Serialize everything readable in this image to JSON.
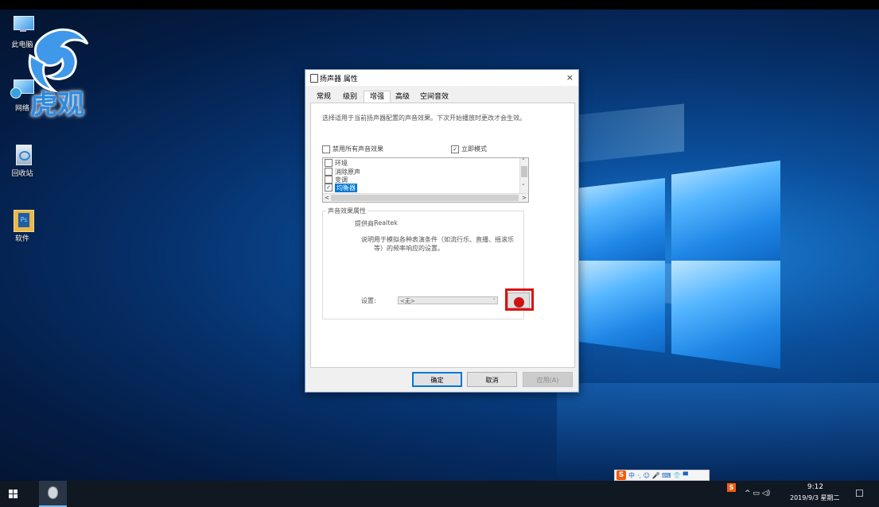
{
  "desktop": {
    "icons": [
      {
        "label": "此电脑"
      },
      {
        "label": "网络"
      },
      {
        "label": "回收站"
      },
      {
        "label": "软件"
      }
    ],
    "watermark": "虎观"
  },
  "dialog": {
    "title": "扬声器 属性",
    "close": "×",
    "tabs": [
      "常规",
      "级别",
      "增强",
      "高级",
      "空间音效"
    ],
    "active_tab": "增强",
    "description": "选择适用于当前扬声器配置的声音效果。下次开始播放时更改才会生效。",
    "disable_all": {
      "label": "禁用所有声音效果",
      "checked": false
    },
    "immediate_mode": {
      "label": "立即模式",
      "checked": true,
      "mark": "✓"
    },
    "effects": [
      {
        "label": "环境",
        "checked": false,
        "mark": ""
      },
      {
        "label": "消除原声",
        "checked": false,
        "mark": ""
      },
      {
        "label": "变调",
        "checked": false,
        "mark": ""
      },
      {
        "label": "均衡器",
        "checked": true,
        "selected": true,
        "mark": "✓"
      }
    ],
    "scroll_arrows": {
      "up": "˄",
      "down": "˅",
      "left": "<",
      "right": ">"
    },
    "properties": {
      "group_title": "声音效果属性",
      "provider_label": "提供商:",
      "provider_value": "Realtek",
      "desc_label": "说明:",
      "desc_value": "用于模拟各种表演条件（如流行乐、直播、摇滚乐等）的频率响应的设置。",
      "settings_label": "设置:",
      "settings_value": "<无>",
      "settings_dropdown": "˅"
    },
    "buttons": {
      "ok": "确定",
      "cancel": "取消",
      "apply": "应用(A)"
    }
  },
  "ime": {
    "brand": "S",
    "mode": "中",
    "icons": "·, ☺ 🎤 ⌨ 👕 ▀"
  },
  "taskbar": {
    "tray_icons": "^  ▭  ◁)",
    "ime_tray": "S",
    "time": "9:12",
    "date": "2019/9/3 星期二",
    "notification": "☐"
  }
}
